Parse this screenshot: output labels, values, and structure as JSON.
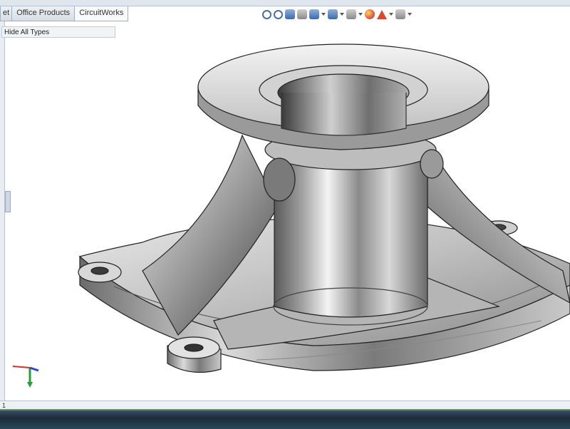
{
  "tabs": [
    {
      "label": "et",
      "active": false
    },
    {
      "label": "Office Products",
      "active": false
    },
    {
      "label": "CircuitWorks",
      "active": true
    }
  ],
  "feature_tree": {
    "hide_types_label": "Hide All Types"
  },
  "heads_up_toolbar": {
    "icons": [
      "zoom-to-fit-icon",
      "zoom-to-area-icon",
      "previous-view-icon",
      "section-view-icon",
      "view-orientation-icon",
      "display-style-icon",
      "hide-show-icon",
      "edit-appearance-icon",
      "apply-scene-icon",
      "view-settings-icon"
    ]
  },
  "status_bar": {
    "text": "1"
  },
  "colors": {
    "tab_border": "#9fb0c2",
    "model_metal_light": "#f2f2f2",
    "model_metal_dark": "#4a4a4a",
    "taskbar": "#1c2b3a"
  }
}
